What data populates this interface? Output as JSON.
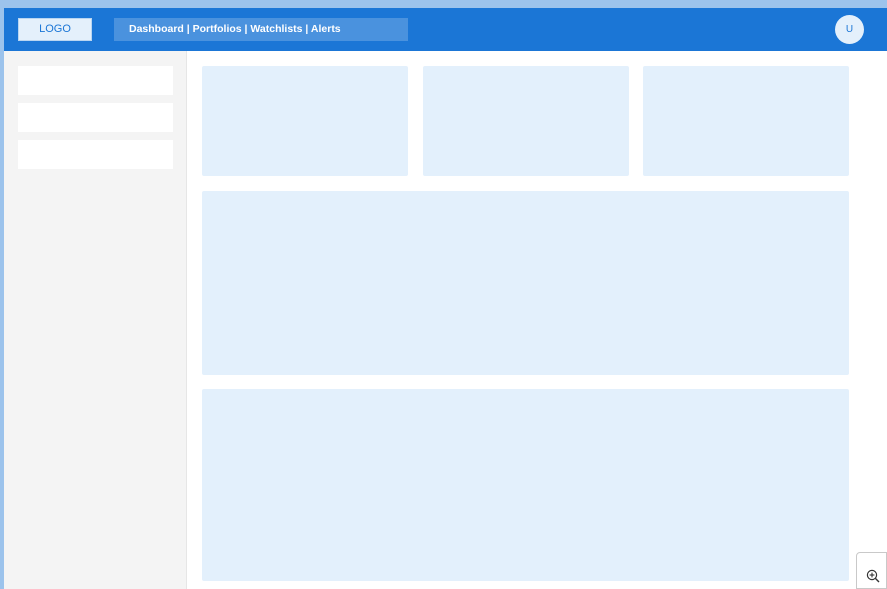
{
  "header": {
    "logo_text": "LOGO",
    "nav_text": "Dashboard | Portfolios | Watchlists | Alerts",
    "avatar_initial": "U"
  },
  "sidebar": {
    "items": [
      "",
      "",
      ""
    ]
  },
  "main": {
    "cards": [
      "",
      "",
      "",
      "",
      ""
    ]
  },
  "icons": {
    "zoom": "zoom-in-icon"
  },
  "colors": {
    "header": "#1b76d6",
    "card": "#e3f0fc",
    "sidebar": "#f4f4f4"
  }
}
